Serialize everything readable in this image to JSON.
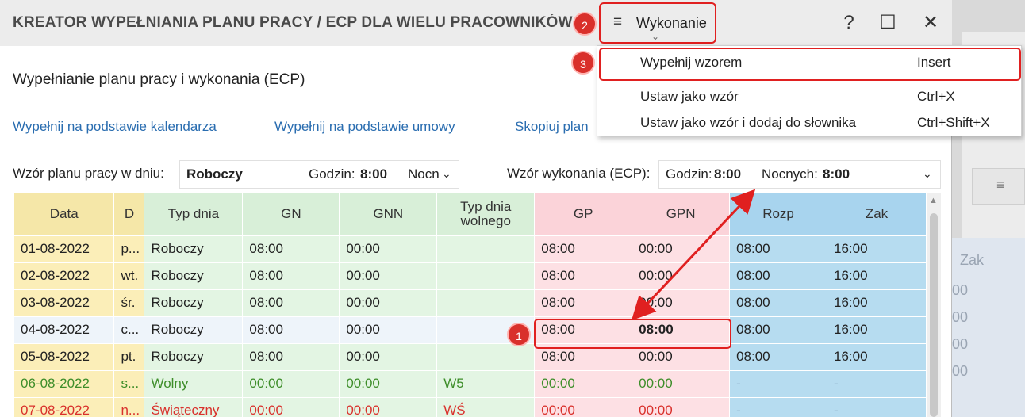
{
  "window": {
    "title": "KREATOR WYPEŁNIANIA PLANU PRACY / ECP DLA WIELU PRACOWNIKÓW",
    "help": "?",
    "maximize": "☐",
    "close": "✕"
  },
  "menu": {
    "icon": "≡",
    "label": "Wykonanie",
    "chevron": "⌄",
    "items": [
      {
        "label": "Wypełnij wzorem",
        "shortcut": "Insert"
      },
      {
        "label": "Ustaw jako wzór",
        "shortcut": "Ctrl+X"
      },
      {
        "label": "Ustaw jako wzór i dodaj do słownika",
        "shortcut": "Ctrl+Shift+X"
      }
    ]
  },
  "badges": [
    "1",
    "2",
    "3"
  ],
  "section_title": "Wypełnianie planu pracy i wykonania (ECP)",
  "links": [
    "Wypełnij na podstawie kalendarza",
    "Wypełnij na podstawie umowy",
    "Skopiuj plan"
  ],
  "plan_pattern": {
    "label": "Wzór planu pracy w dniu:",
    "day_type": "Roboczy",
    "hours_label": "Godzin:",
    "hours": "8:00",
    "night_label": "Nocn"
  },
  "exec_pattern": {
    "label": "Wzór wykonania (ECP):",
    "hours_label": "Godzin:",
    "hours": "8:00",
    "night_label": "Nocnych:",
    "night": "8:00"
  },
  "table": {
    "columns": [
      "Data",
      "D",
      "Typ dnia",
      "GN",
      "GNN",
      "Typ dnia wolnego",
      "GP",
      "GPN",
      "Rozp",
      "Zak"
    ],
    "rows": [
      {
        "style": "",
        "cells": [
          "01-08-2022",
          "p...",
          "Roboczy",
          "08:00",
          "00:00",
          "",
          "08:00",
          "00:00",
          "08:00",
          "16:00"
        ]
      },
      {
        "style": "",
        "cells": [
          "02-08-2022",
          "wt.",
          "Roboczy",
          "08:00",
          "00:00",
          "",
          "08:00",
          "00:00",
          "08:00",
          "16:00"
        ]
      },
      {
        "style": "",
        "cells": [
          "03-08-2022",
          "śr.",
          "Roboczy",
          "08:00",
          "00:00",
          "",
          "08:00",
          "00:00",
          "08:00",
          "16:00"
        ]
      },
      {
        "style": "sel",
        "cells": [
          "04-08-2022",
          "c...",
          "Roboczy",
          "08:00",
          "00:00",
          "",
          "08:00",
          "08:00",
          "08:00",
          "16:00"
        ]
      },
      {
        "style": "",
        "cells": [
          "05-08-2022",
          "pt.",
          "Roboczy",
          "08:00",
          "00:00",
          "",
          "08:00",
          "00:00",
          "08:00",
          "16:00"
        ]
      },
      {
        "style": "green",
        "cells": [
          "06-08-2022",
          "s...",
          "Wolny",
          "00:00",
          "00:00",
          "W5",
          "00:00",
          "00:00",
          "-",
          "-"
        ]
      },
      {
        "style": "red",
        "cells": [
          "07-08-2022",
          "n...",
          "Świąteczny",
          "00:00",
          "00:00",
          "WŚ",
          "00:00",
          "00:00",
          "-",
          "-"
        ]
      }
    ]
  },
  "background_window": {
    "menu_icon": "≡",
    "col": "Zak",
    "values": [
      "00",
      "00",
      "00",
      "00"
    ]
  },
  "colors": {
    "highlight": "#e02020",
    "link": "#2a6db0",
    "weekend": "#3e8e2a",
    "holiday": "#d9302b"
  }
}
